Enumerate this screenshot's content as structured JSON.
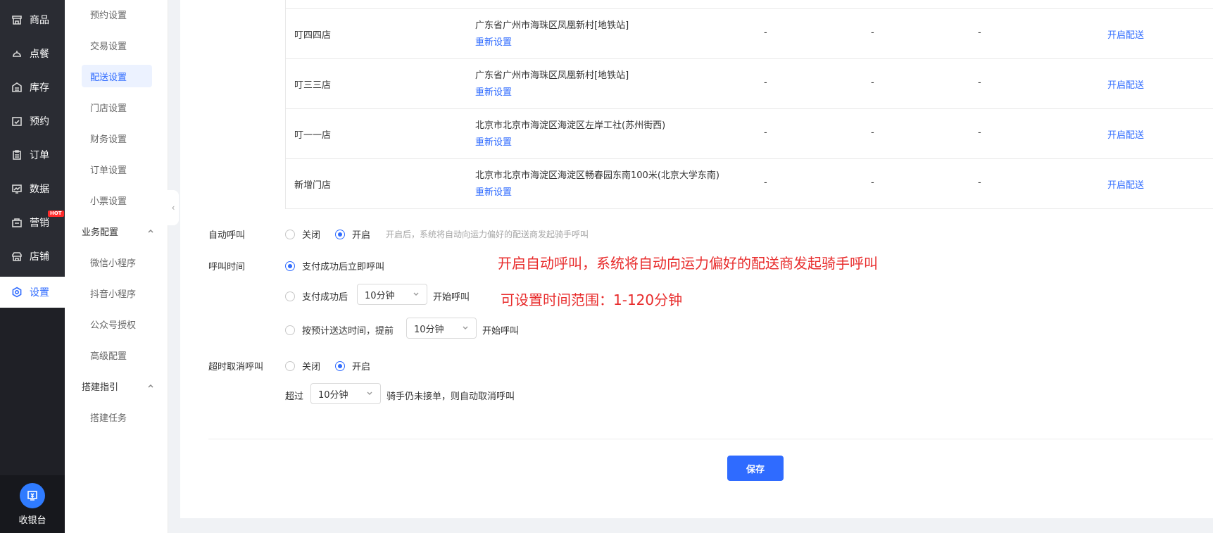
{
  "leftnav": {
    "items": [
      {
        "label": "商品",
        "icon": "shop-icon"
      },
      {
        "label": "点餐",
        "icon": "dish-icon"
      },
      {
        "label": "库存",
        "icon": "inventory-icon"
      },
      {
        "label": "预约",
        "icon": "calendar-check-icon"
      },
      {
        "label": "订单",
        "icon": "clipboard-icon"
      },
      {
        "label": "数据",
        "icon": "chart-icon"
      },
      {
        "label": "营销",
        "icon": "marketing-icon",
        "badge": "HOT"
      },
      {
        "label": "店铺",
        "icon": "store-icon"
      },
      {
        "label": "设置",
        "icon": "gear-icon"
      }
    ],
    "cashier_label": "收银台"
  },
  "submenu": {
    "items_top": [
      "预约设置",
      "交易设置",
      "配送设置",
      "门店设置",
      "财务设置",
      "订单设置",
      "小票设置"
    ],
    "group1": "业务配置",
    "group1_items": [
      "微信小程序",
      "抖音小程序",
      "公众号授权",
      "高级配置"
    ],
    "group2": "搭建指引",
    "group2_items": [
      "搭建任务"
    ]
  },
  "table": {
    "rows": [
      {
        "store": "叮四四店",
        "address": "广东省广州市海珠区凤凰新村[地铁站]",
        "reset": "重新设置",
        "c1": "-",
        "c2": "-",
        "c3": "-",
        "action": "开启配送"
      },
      {
        "store": "叮三三店",
        "address": "广东省广州市海珠区凤凰新村[地铁站]",
        "reset": "重新设置",
        "c1": "-",
        "c2": "-",
        "c3": "-",
        "action": "开启配送"
      },
      {
        "store": "叮一一店",
        "address": "北京市北京市海淀区海淀区左岸工社(苏州街西)",
        "reset": "重新设置",
        "c1": "-",
        "c2": "-",
        "c3": "-",
        "action": "开启配送"
      },
      {
        "store": "新增门店",
        "address": "北京市北京市海淀区海淀区畅春园东南100米(北京大学东南)",
        "reset": "重新设置",
        "c1": "-",
        "c2": "-",
        "c3": "-",
        "action": "开启配送"
      }
    ]
  },
  "form": {
    "auto_call": {
      "label": "自动呼叫",
      "off": "关闭",
      "on": "开启",
      "selected": "开启",
      "hint": "开启后，系统将自动向运力偏好的配送商发起骑手呼叫"
    },
    "call_time": {
      "label": "呼叫时间",
      "opt1": "支付成功后立即呼叫",
      "opt2_prefix": "支付成功后",
      "opt2_select": "10分钟",
      "opt2_suffix": "开始呼叫",
      "opt3_prefix": "按预计送达时间，提前",
      "opt3_select": "10分钟",
      "opt3_suffix": "开始呼叫",
      "selected": "支付成功后立即呼叫"
    },
    "timeout_cancel": {
      "label": "超时取消呼叫",
      "off": "关闭",
      "on": "开启",
      "selected": "开启",
      "prefix": "超过",
      "select": "10分钟",
      "suffix": "骑手仍未接单，则自动取消呼叫"
    },
    "save": "保存"
  },
  "annotations": {
    "a1": "开启自动呼叫，系统将自动向运力偏好的配送商发起骑手呼叫",
    "a2": "可设置时间范围：1-120分钟"
  }
}
